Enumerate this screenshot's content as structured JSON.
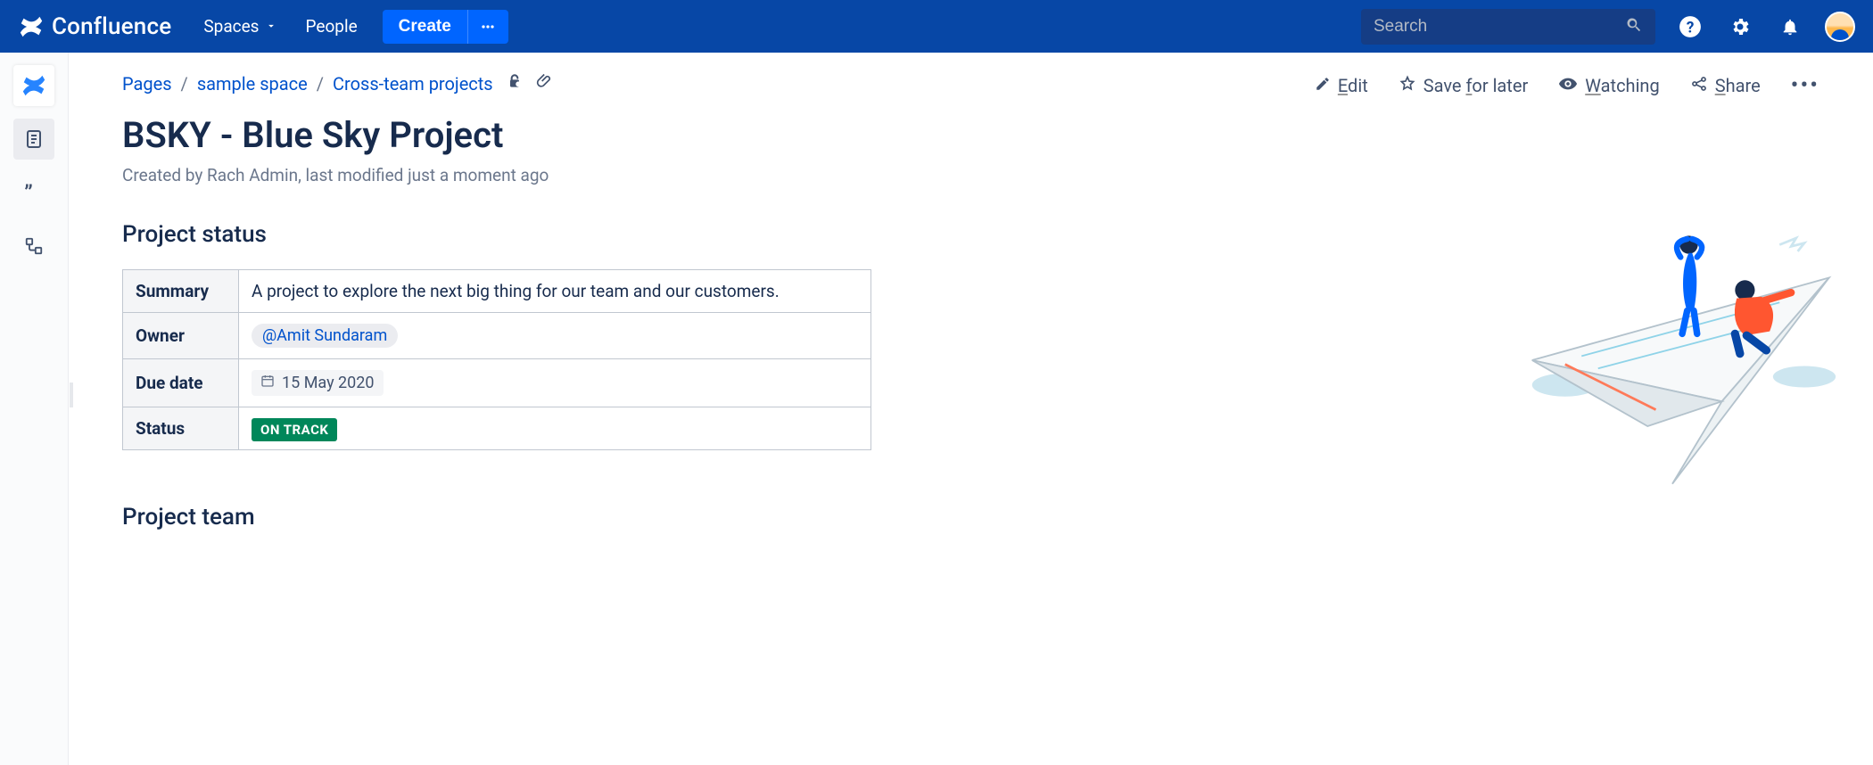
{
  "topnav": {
    "product": "Confluence",
    "spaces": "Spaces",
    "people": "People",
    "create": "Create",
    "search_placeholder": "Search"
  },
  "breadcrumbs": {
    "root": "Pages",
    "space": "sample space",
    "parent": "Cross-team projects"
  },
  "page_actions": {
    "edit": "Edit",
    "save": "Save for later",
    "watch": "Watching",
    "share": "Share"
  },
  "page": {
    "title": "BSKY - Blue Sky Project",
    "byline": "Created by Rach Admin, last modified just a moment ago"
  },
  "sections": {
    "status_heading": "Project status",
    "team_heading": "Project team"
  },
  "status_table": {
    "summary_label": "Summary",
    "summary_value": "A project to explore the next big thing for our team and our customers.",
    "owner_label": "Owner",
    "owner_value": "@Amit Sundaram",
    "due_label": "Due date",
    "due_value": "15 May 2020",
    "status_label": "Status",
    "status_value": "ON TRACK"
  }
}
